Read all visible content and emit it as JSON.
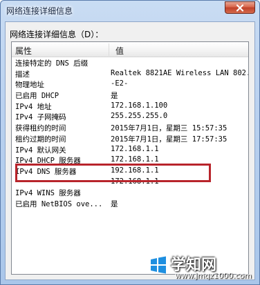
{
  "window": {
    "title": "网络连接详细信息",
    "close_icon": "close-x"
  },
  "group_label": "网络连接详细信息（D）：",
  "list": {
    "columns": [
      "属性",
      "值"
    ],
    "rows": [
      {
        "property": "连接特定的 DNS 后缀",
        "value": ""
      },
      {
        "property": "描述",
        "value": "Realtek 8821AE Wireless LAN 802.1"
      },
      {
        "property": "物理地址",
        "value": "-E2-"
      },
      {
        "property": "已启用 DHCP",
        "value": "是"
      },
      {
        "property": "IPv4 地址",
        "value": "172.168.1.100"
      },
      {
        "property": "IPv4 子网掩码",
        "value": "255.255.255.0"
      },
      {
        "property": "获得租约的时间",
        "value": "2015年7月1日，星期三 15:57:35"
      },
      {
        "property": "租约过期的时间",
        "value": "2015年7月1日，星期三 17:57:35"
      },
      {
        "property": "IPv4 默认网关",
        "value": "172.168.1.1"
      },
      {
        "property": "IPv4 DHCP 服务器",
        "value": "172.168.1.1"
      },
      {
        "property": "IPv4 DNS 服务器",
        "value": "192.168.1.1"
      },
      {
        "property": "",
        "value": "172.168.1.1"
      },
      {
        "property": "IPv4 WINS 服务器",
        "value": ""
      },
      {
        "property": "已启用 NetBIOS ove...",
        "value": "是"
      }
    ]
  },
  "highlight_color": "#b8242b",
  "watermark": {
    "logo_icon": "windows-flag-icon",
    "text": "学知网",
    "url": "www.jmqz1000.com"
  }
}
